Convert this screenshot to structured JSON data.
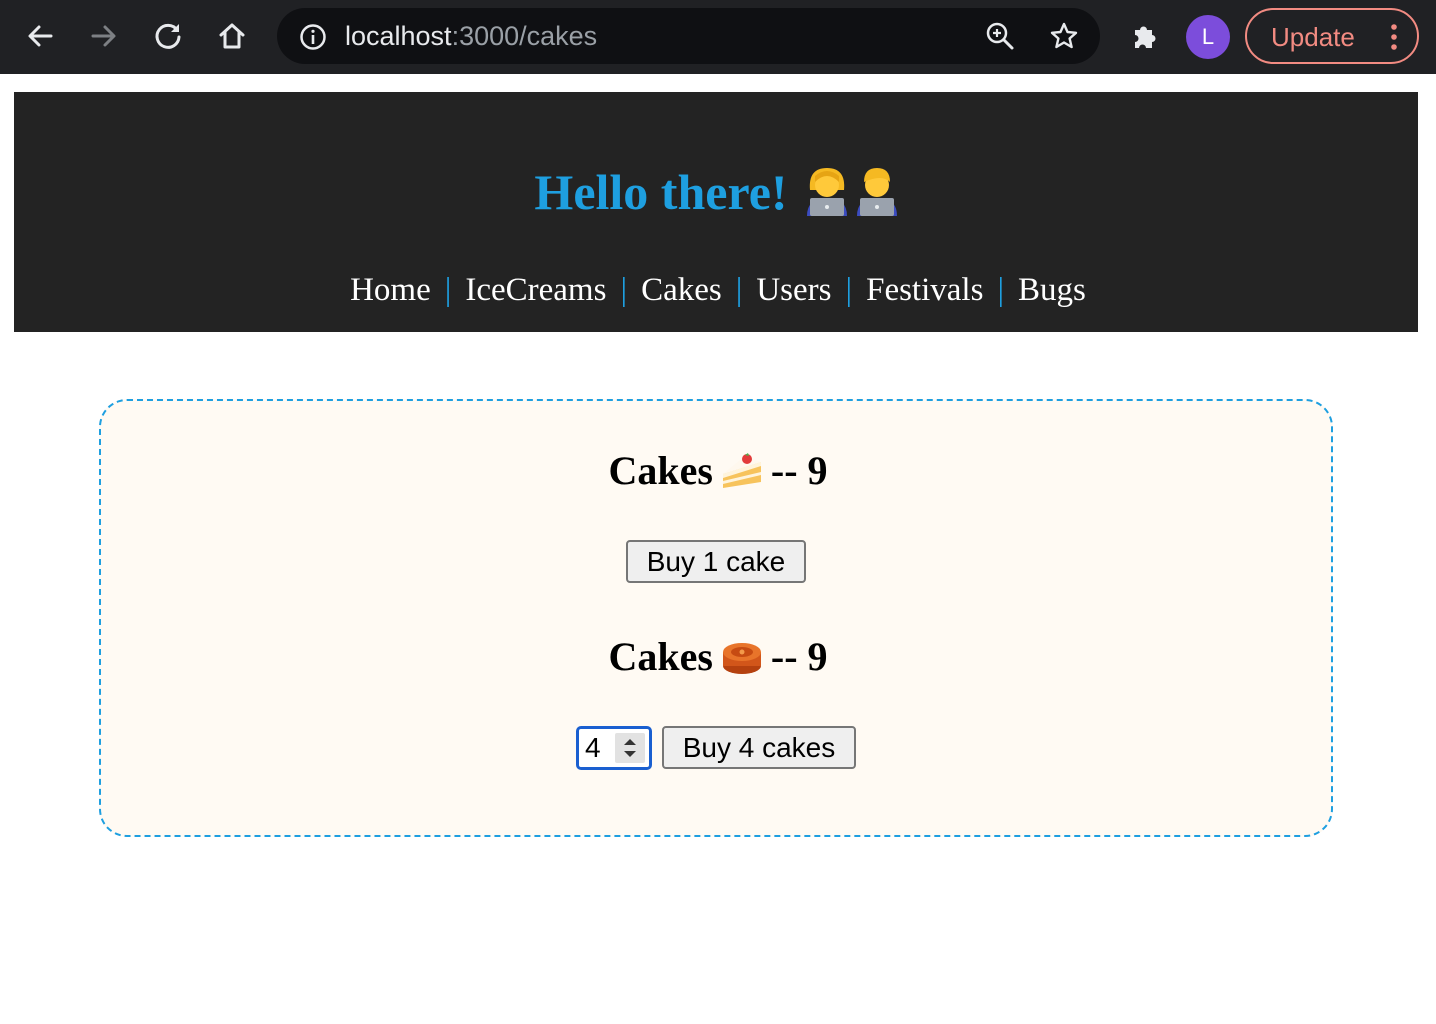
{
  "browser": {
    "url_host": "localhost",
    "url_path": ":3000/cakes",
    "profile_initial": "L",
    "update_label": "Update",
    "icons": [
      "back-icon",
      "forward-icon",
      "reload-icon",
      "home-icon",
      "info-icon",
      "zoom-icon",
      "star-icon",
      "extensions-icon",
      "more-vertical-icon"
    ]
  },
  "header": {
    "title": "Hello there!",
    "nav": {
      "home": "Home",
      "icecreams": "IceCreams",
      "cakes": "Cakes",
      "users": "Users",
      "festivals": "Festivals",
      "bugs": "Bugs",
      "separator": "|"
    }
  },
  "cakes": {
    "section1": {
      "label": "Cakes",
      "suffix": "-- 9",
      "button": "Buy 1 cake"
    },
    "section2": {
      "label": "Cakes",
      "suffix": "-- 9",
      "quantity": "4",
      "button": "Buy 4 cakes"
    }
  },
  "colors": {
    "accent": "#1e9fe0",
    "header_bg": "#232323",
    "card_bg": "#fffaf3",
    "update": "#f28b82",
    "avatar": "#7c4ddb"
  }
}
